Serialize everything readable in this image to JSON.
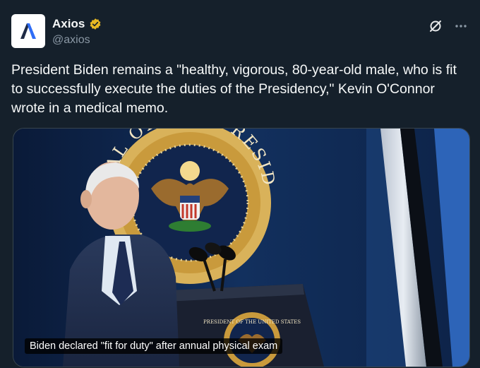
{
  "author": {
    "display_name": "Axios",
    "handle": "@axios",
    "verified": true,
    "avatar_icon": "axios-logo-icon",
    "verified_color": "#e8b923"
  },
  "tweet": {
    "text": "President Biden remains a \"healthy, vigorous, 80-year-old male, who is fit to successfully execute the duties of the Presidency,\" Kevin O'Connor wrote in a medical memo."
  },
  "actions": {
    "grok_icon": "slash-circle-icon",
    "more_icon": "more-options-icon"
  },
  "media": {
    "caption": "Biden declared \"fit for duty\" after annual physical exam",
    "seal_text": "SEAL OF THE PRESIDENT OF THE UNITED STATES",
    "podium_text": "PRESIDENT OF THE UNITED STATES"
  }
}
